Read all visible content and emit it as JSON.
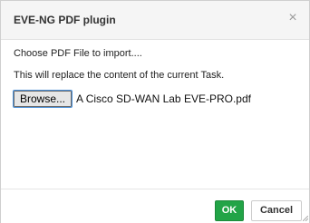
{
  "dialog": {
    "title": "EVE-NG PDF plugin",
    "close_glyph": "×"
  },
  "body": {
    "instruction": "Choose PDF File to import....",
    "warning": "This will replace the content of the current Task.",
    "browse_label": "Browse...",
    "selected_file": "A Cisco SD-WAN Lab EVE-PRO.pdf"
  },
  "footer": {
    "ok_label": "OK",
    "cancel_label": "Cancel"
  },
  "colors": {
    "ok_button": "#22a447",
    "header_bg": "#f5f5f5"
  },
  "icons": {
    "close": "close-icon",
    "resize": "resize-grip-icon"
  }
}
